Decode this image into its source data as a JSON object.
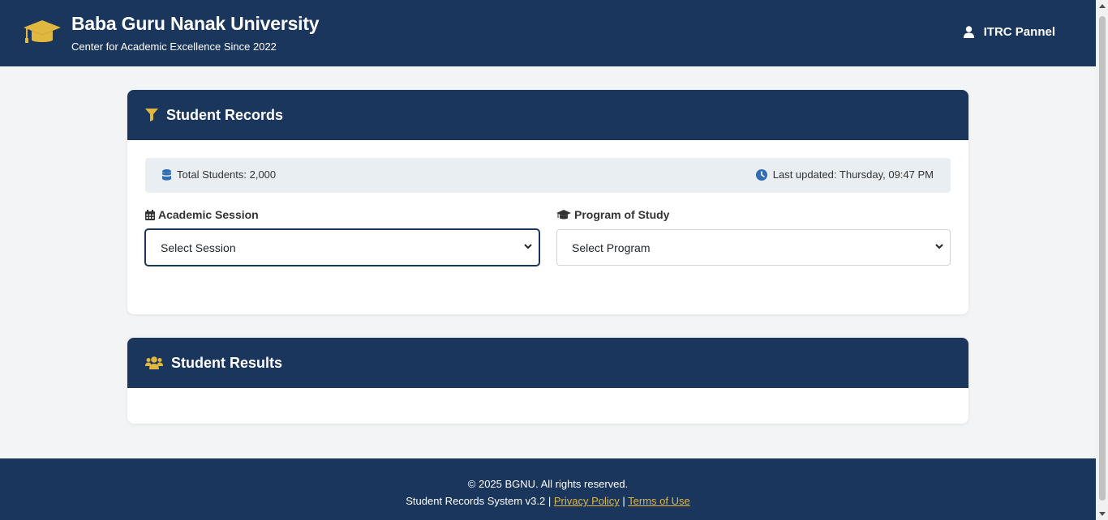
{
  "header": {
    "title": "Baba Guru Nanak University",
    "subtitle": "Center for Academic Excellence Since 2022",
    "user_label": "ITRC Pannel",
    "logo_icon": "graduation-cap-icon",
    "user_icon": "user-icon"
  },
  "records": {
    "title": "Student Records",
    "title_icon": "filter-icon",
    "total_students": "Total Students: 2,000",
    "last_updated": "Last updated: Thursday, 09:47 PM",
    "session_label": "Academic Session",
    "session_value": "Select Session",
    "program_label": "Program of Study",
    "program_value": "Select Program"
  },
  "results": {
    "title": "Student Results",
    "title_icon": "users-icon"
  },
  "footer": {
    "copyright": "© 2025 BGNU. All rights reserved.",
    "system": "Student Records System v3.2 |",
    "privacy": "Privacy Policy",
    "separator": "|",
    "terms": "Terms of Use"
  },
  "colors": {
    "primary": "#1b365d",
    "accent": "#e0b73f",
    "info_icon": "#2f6db5"
  }
}
